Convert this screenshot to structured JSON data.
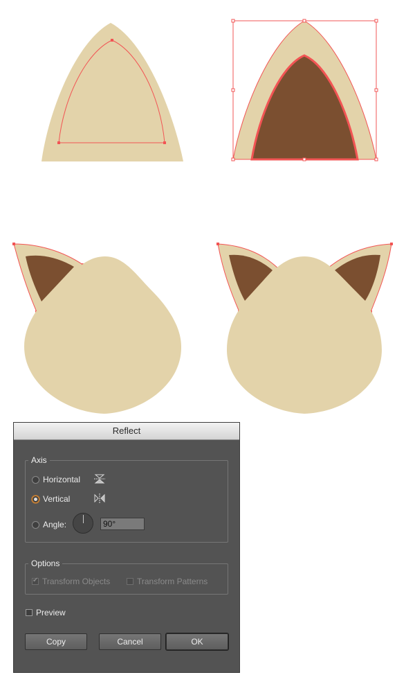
{
  "colors": {
    "ear_outer": "#e3d3aa",
    "ear_inner": "#7b4f30",
    "selection": "#f25454",
    "dialog_bg": "#535353"
  },
  "dialog": {
    "title": "Reflect",
    "axis": {
      "legend": "Axis",
      "horizontal_label": "Horizontal",
      "vertical_label": "Vertical",
      "angle_label": "Angle:",
      "angle_value": "90°",
      "selected": "Vertical",
      "horizontal_icon": "reflect-horizontal-icon",
      "vertical_icon": "reflect-vertical-icon"
    },
    "options": {
      "legend": "Options",
      "transform_objects_label": "Transform Objects",
      "transform_objects_checked": true,
      "transform_patterns_label": "Transform Patterns",
      "transform_patterns_checked": false
    },
    "preview_label": "Preview",
    "preview_checked": false,
    "buttons": {
      "copy": "Copy",
      "cancel": "Cancel",
      "ok": "OK"
    }
  }
}
